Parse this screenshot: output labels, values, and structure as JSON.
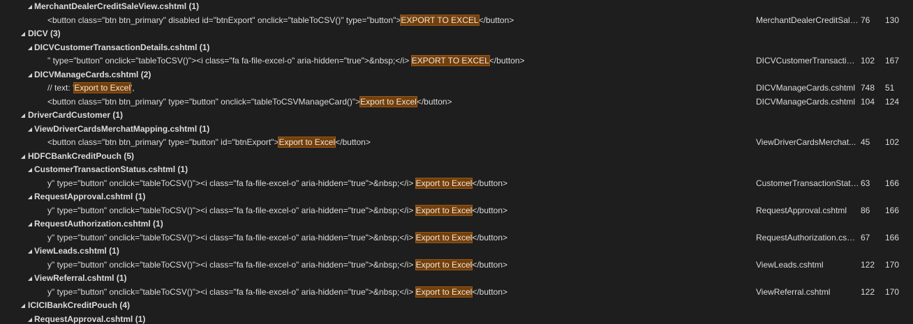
{
  "rows": [
    {
      "kind": "file",
      "level": 1,
      "label": "MerchantDealerCreditSaleView.cshtml",
      "count": "(1)"
    },
    {
      "kind": "match",
      "before": "<button class=\"btn btn_primary\" disabled id=\"btnExport\" onclick=\"tableToCSV()\" type=\"button\">",
      "hit": "EXPORT TO EXCEL",
      "after": "</button>",
      "file": "MerchantDealerCreditSale...",
      "line": "76",
      "col": "130"
    },
    {
      "kind": "folder",
      "level": 0,
      "label": "DICV",
      "count": "(3)"
    },
    {
      "kind": "file",
      "level": 1,
      "label": "DICVCustomerTransactionDetails.cshtml",
      "count": "(1)"
    },
    {
      "kind": "match",
      "before": "\" type=\"button\"  onclick=\"tableToCSV()\"><i class=\"fa fa-file-excel-o\" aria-hidden=\"true\">&nbsp;</i> ",
      "hit": "EXPORT TO EXCEL",
      "after": "</button>",
      "file": "DICVCustomerTransaction...",
      "line": "102",
      "col": "167"
    },
    {
      "kind": "file",
      "level": 1,
      "label": "DICVManageCards.cshtml",
      "count": "(2)"
    },
    {
      "kind": "match",
      "before": "//        text: '",
      "hit": "Export to Excel",
      "after": "',",
      "file": "DICVManageCards.cshtml",
      "line": "748",
      "col": "51"
    },
    {
      "kind": "match",
      "before": "<button class=\"btn btn_primary\" type=\"button\" onclick=\"tableToCSVManageCard()\">",
      "hit": "Export to Excel",
      "after": "</button>",
      "file": "DICVManageCards.cshtml",
      "line": "104",
      "col": "124"
    },
    {
      "kind": "folder",
      "level": 0,
      "label": "DriverCardCustomer",
      "count": "(1)"
    },
    {
      "kind": "file",
      "level": 1,
      "label": "ViewDriverCardsMerchatMapping.cshtml",
      "count": "(1)"
    },
    {
      "kind": "match",
      "before": "<button class=\"btn btn_primary\" type=\"button\" id=\"btnExport\">",
      "hit": "Export to Excel",
      "after": "</button>",
      "file": "ViewDriverCardsMerchat...",
      "line": "45",
      "col": "102"
    },
    {
      "kind": "folder",
      "level": 0,
      "label": "HDFCBankCreditPouch",
      "count": "(5)"
    },
    {
      "kind": "file",
      "level": 1,
      "label": "CustomerTransactionStatus.cshtml",
      "count": "(1)"
    },
    {
      "kind": "match",
      "before": "y\" type=\"button\" onclick=\"tableToCSV()\"><i class=\"fa fa-file-excel-o\" aria-hidden=\"true\">&nbsp;</i> ",
      "hit": "Export to Excel",
      "after": "</button>",
      "file": "CustomerTransactionStatu...",
      "line": "63",
      "col": "166"
    },
    {
      "kind": "file",
      "level": 1,
      "label": "RequestApproval.cshtml",
      "count": "(1)"
    },
    {
      "kind": "match",
      "before": "y\" type=\"button\" onclick=\"tableToCSV()\"><i class=\"fa fa-file-excel-o\" aria-hidden=\"true\">&nbsp;</i> ",
      "hit": "Export to Excel",
      "after": "</button>",
      "file": "RequestApproval.cshtml",
      "line": "86",
      "col": "166"
    },
    {
      "kind": "file",
      "level": 1,
      "label": "RequestAuthorization.cshtml",
      "count": "(1)"
    },
    {
      "kind": "match",
      "before": "y\" type=\"button\" onclick=\"tableToCSV()\"><i class=\"fa fa-file-excel-o\" aria-hidden=\"true\">&nbsp;</i> ",
      "hit": "Export to Excel",
      "after": "</button>",
      "file": "RequestAuthorization.csht...",
      "line": "67",
      "col": "166"
    },
    {
      "kind": "file",
      "level": 1,
      "label": "ViewLeads.cshtml",
      "count": "(1)"
    },
    {
      "kind": "match",
      "before": "y\" type=\"button\" onclick=\"tableToCSV()\"><i class=\"fa fa-file-excel-o\" aria-hidden=\"true\">&nbsp;</i> ",
      "hit": "Export to Excel",
      "after": "</button>",
      "file": "ViewLeads.cshtml",
      "line": "122",
      "col": "170"
    },
    {
      "kind": "file",
      "level": 1,
      "label": "ViewReferral.cshtml",
      "count": "(1)"
    },
    {
      "kind": "match",
      "before": "y\" type=\"button\" onclick=\"tableToCSV()\"><i class=\"fa fa-file-excel-o\" aria-hidden=\"true\">&nbsp;</i> ",
      "hit": "Export to Excel",
      "after": "</button>",
      "file": "ViewReferral.cshtml",
      "line": "122",
      "col": "170"
    },
    {
      "kind": "folder",
      "level": 0,
      "label": "ICICIBankCreditPouch",
      "count": "(4)"
    },
    {
      "kind": "file",
      "level": 1,
      "label": "RequestApproval.cshtml",
      "count": "(1)"
    }
  ],
  "expander_glyph": "◢",
  "colors": {
    "background": "#1e1e1e",
    "text": "#dcdcdc",
    "highlight_bg": "#733f0b"
  }
}
